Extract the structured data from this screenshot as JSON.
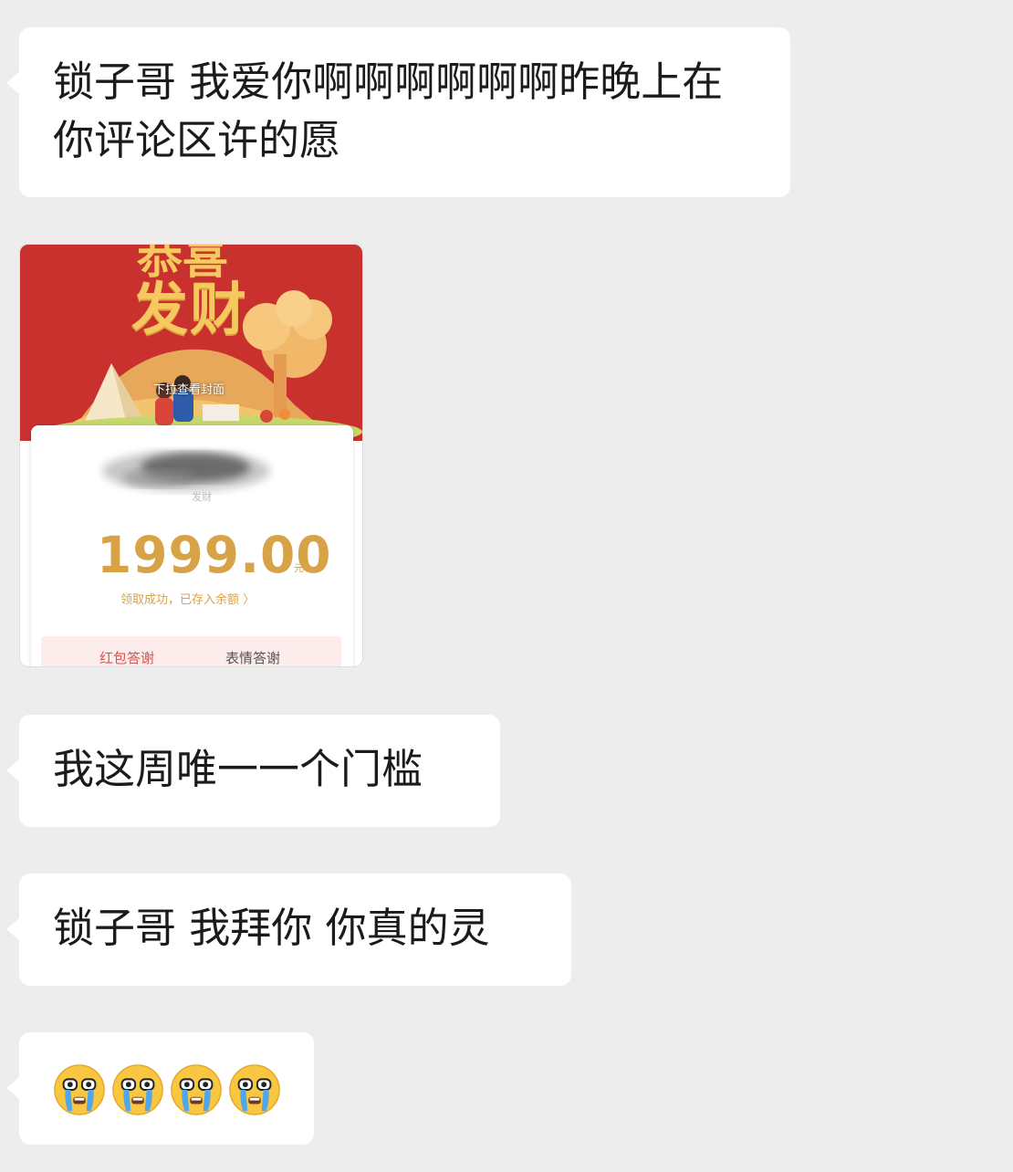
{
  "messages": [
    {
      "id": "m1",
      "type": "text",
      "text": "锁子哥 我爱你啊啊啊啊啊啊昨晚上在你评论区许的愿"
    },
    {
      "id": "m3",
      "type": "text",
      "text": "我这周唯一一个门槛"
    },
    {
      "id": "m4",
      "type": "text",
      "text": "锁子哥 我拜你 你真的灵"
    },
    {
      "id": "m5",
      "type": "emoji",
      "emoji_count": 4,
      "emoji_icon": "crying-face-icon"
    }
  ],
  "red_packet": {
    "cover_title": "发财",
    "cover_title_partial": "恭喜",
    "pull_hint": "下拉查看封面",
    "sender_suffix": "发财",
    "amount": "1999.00",
    "unit": "元",
    "claimed_text": "领取成功，已存入余额 〉",
    "actions": {
      "red_packet_thanks": "红包答谢",
      "sticker_thanks": "表情答谢"
    },
    "colors": {
      "cover": "#c8312e",
      "gold": "#d8a346",
      "title": "#f5c860"
    }
  }
}
